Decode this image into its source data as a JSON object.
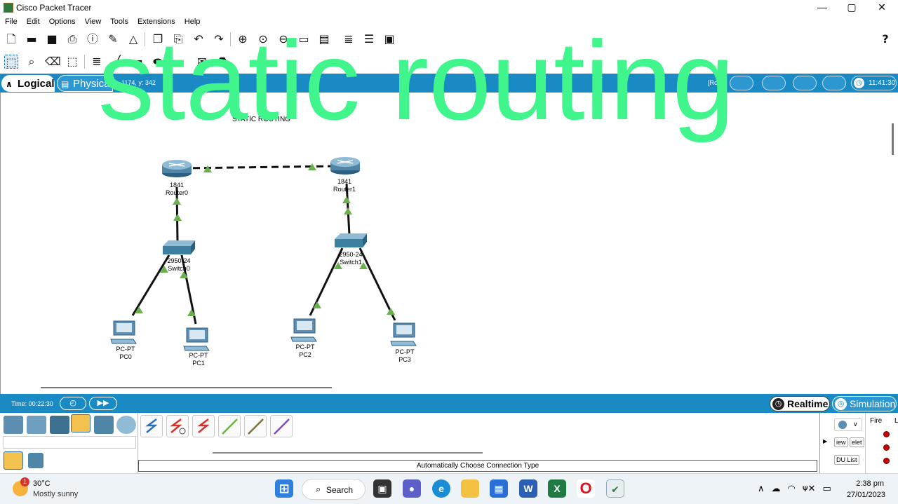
{
  "window": {
    "title": "Cisco Packet Tracer",
    "minimize": "—",
    "maximize": "▢",
    "close": "✕"
  },
  "menu": [
    "File",
    "Edit",
    "Options",
    "View",
    "Tools",
    "Extensions",
    "Help"
  ],
  "toolbar1": {
    "icons": [
      "new-file-icon",
      "open-folder-icon",
      "save-icon",
      "print-icon",
      "info-icon",
      "activity-wizard-icon",
      "network-info-icon",
      "copy-icon",
      "paste-icon",
      "undo-icon",
      "redo-icon",
      "zoom-in-icon",
      "zoom-reset-icon",
      "zoom-out-icon",
      "drawing-palette-icon",
      "custom-devices-icon",
      "notes-icon",
      "pdu-list-icon",
      "screenshot-icon"
    ],
    "help": "?"
  },
  "toolbar2": {
    "icons": [
      "select-icon",
      "inspect-icon",
      "delete-icon",
      "resize-icon",
      "place-note-icon",
      "draw-line-icon",
      "draw-rectangle-icon",
      "draw-ellipse-icon",
      "add-simple-pdu-icon",
      "add-complex-pdu-icon"
    ]
  },
  "viewbar": {
    "logical": "Logical",
    "physical": "Physical",
    "coords": "1174, y: 342",
    "ro": "[Ro",
    "clock": "11:41:30"
  },
  "workspace": {
    "note": "STATIC ROUTING",
    "overlay": "static routing",
    "devices": [
      {
        "model": "1841",
        "name": "Router0"
      },
      {
        "model": "1841",
        "name": "Router1"
      },
      {
        "model": "2950-24",
        "name": "Switch0"
      },
      {
        "model": "2950-24",
        "name": "Switch1"
      },
      {
        "model": "PC-PT",
        "name": "PC0"
      },
      {
        "model": "PC-PT",
        "name": "PC1"
      },
      {
        "model": "PC-PT",
        "name": "PC2"
      },
      {
        "model": "PC-PT",
        "name": "PC3"
      }
    ],
    "colors": {
      "router": "#5a8fb0",
      "switch": "#3d7f9f",
      "pc": "#5d8db0",
      "link_up": "#6ab04c",
      "cable": "#111111"
    }
  },
  "timebar": {
    "time": "Time: 00:22:30",
    "realtime": "Realtime",
    "simulation": "Simulation"
  },
  "bottom": {
    "status": "Automatically Choose Connection Type",
    "right_buttons": [
      "iew",
      "elet",
      "DU List"
    ],
    "fire": "Fire",
    "last_col": "L"
  },
  "taskbar": {
    "temperature": "30°C",
    "weather": "Mostly sunny",
    "weather_badge": "1",
    "search": "Search",
    "time": "2:38 pm",
    "date": "27/01/2023"
  }
}
